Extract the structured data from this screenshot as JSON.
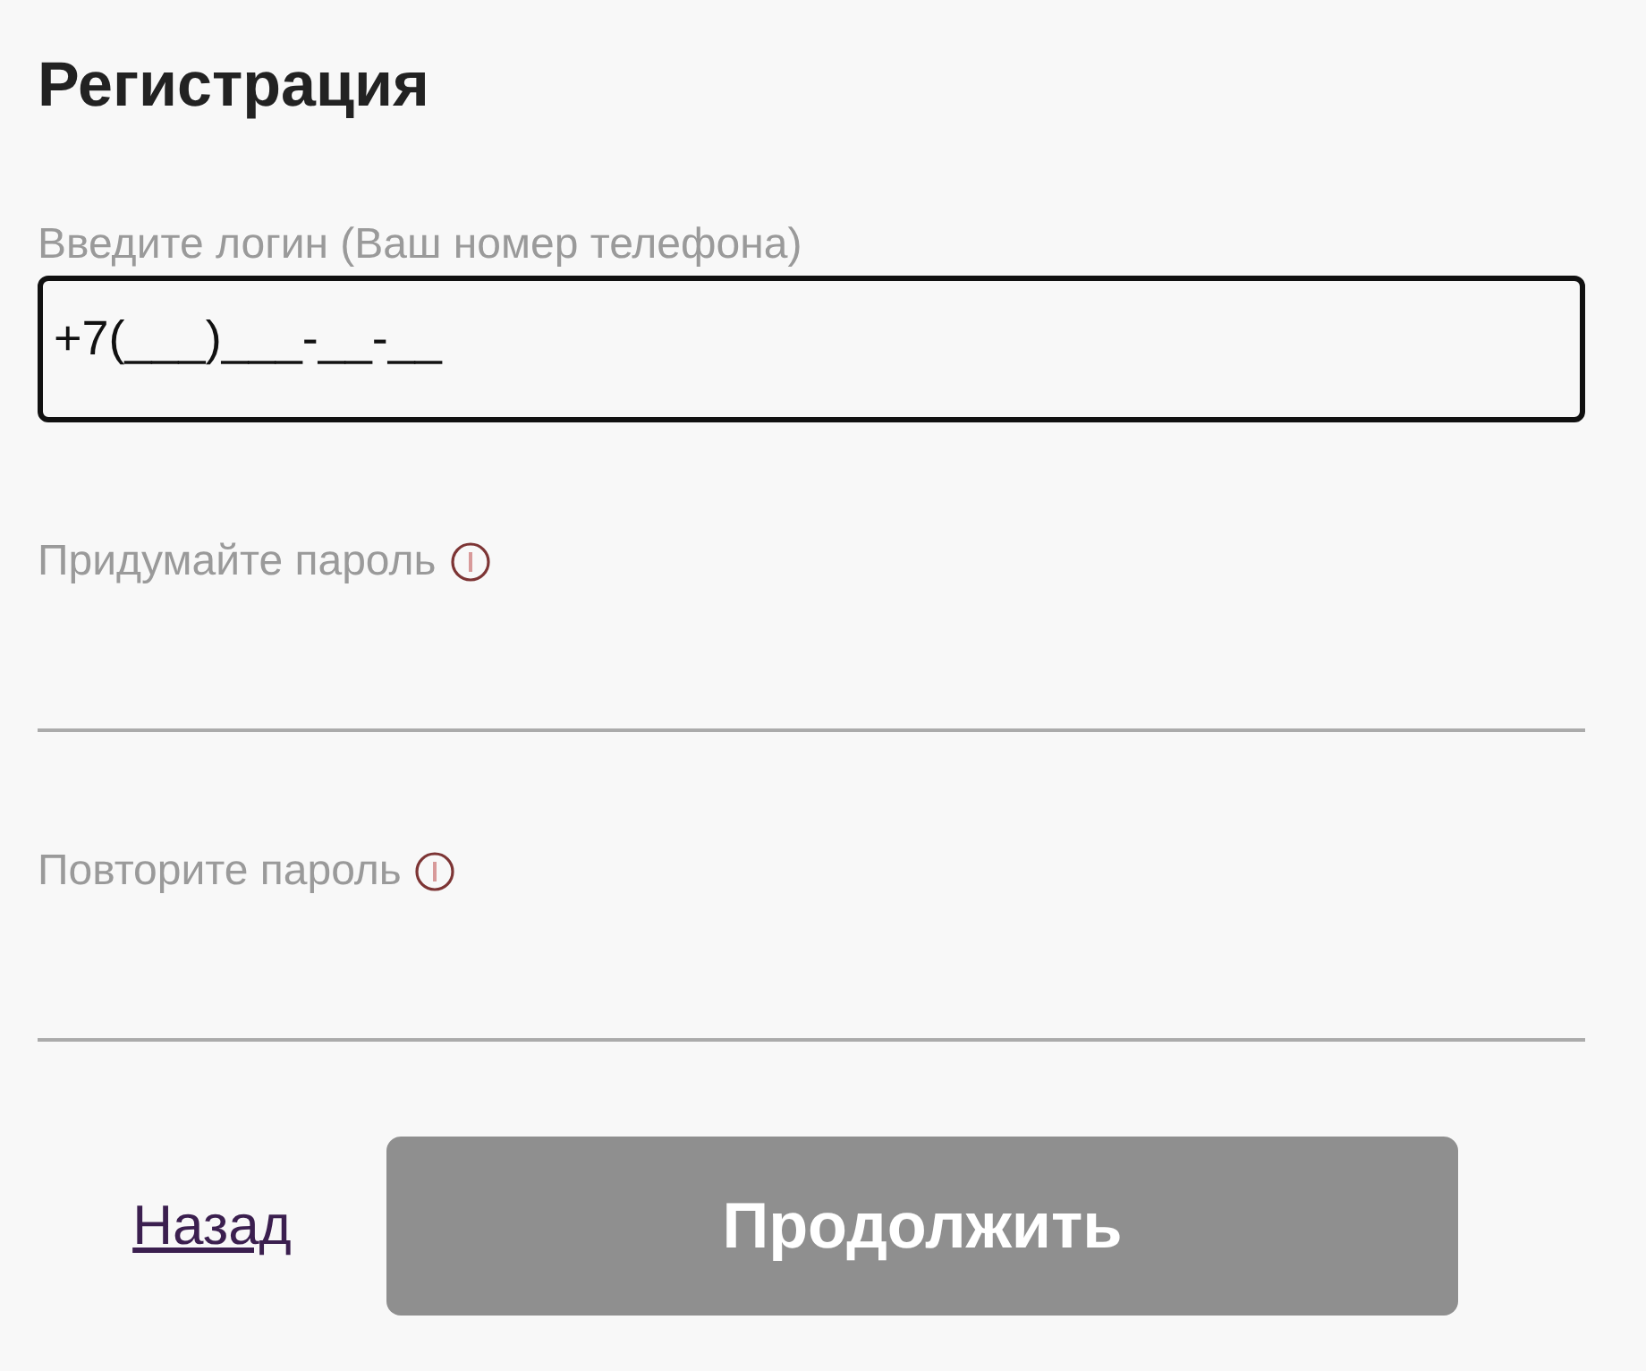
{
  "title": "Регистрация",
  "fields": [
    {
      "label": "Введите логин (Ваш номер телефона)",
      "hint_icon": false,
      "focused": true,
      "value": "+7(___)___-__-__"
    },
    {
      "label": "Придумайте пароль",
      "hint_icon": true,
      "focused": false
    },
    {
      "label": "Повторите пароль",
      "hint_icon": true,
      "focused": false
    }
  ],
  "back_link": "Назад",
  "submit": {
    "label": "Продолжить",
    "disabled": true
  }
}
